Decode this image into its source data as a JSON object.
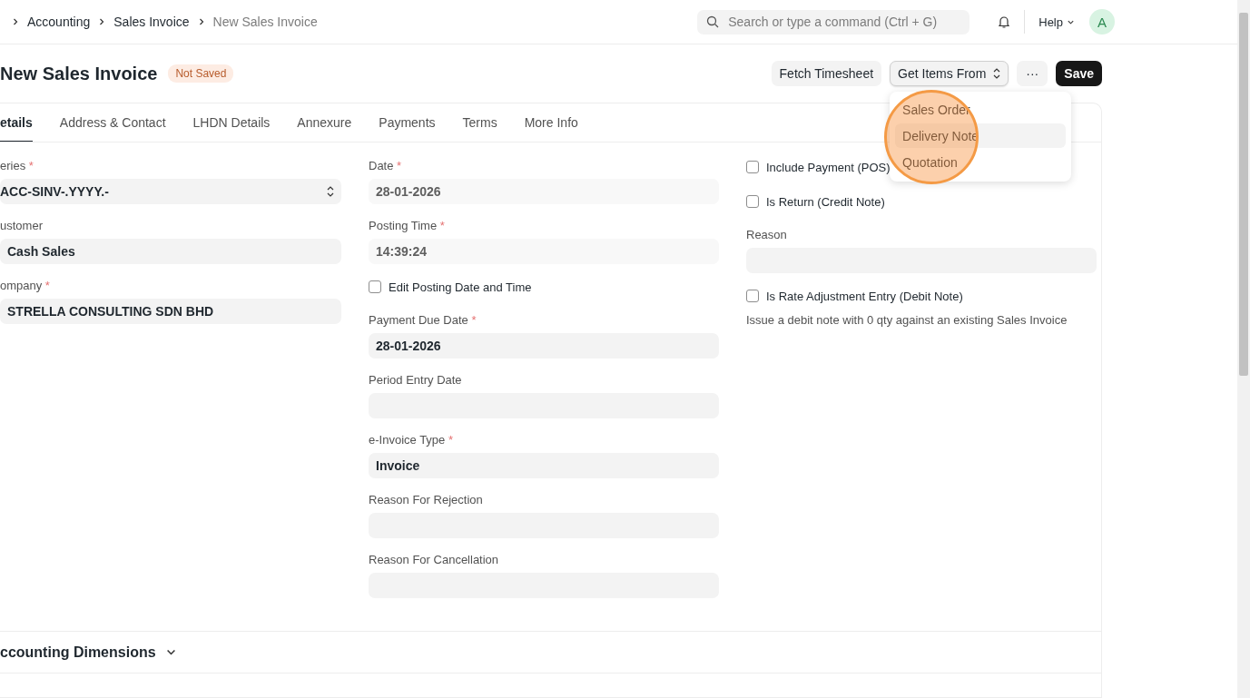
{
  "breadcrumbs": [
    {
      "label": "Accounting",
      "current": false
    },
    {
      "label": "Sales Invoice",
      "current": false
    },
    {
      "label": "New Sales Invoice",
      "current": true
    }
  ],
  "search": {
    "placeholder": "Search or type a command (Ctrl + G)"
  },
  "help": {
    "label": "Help"
  },
  "avatar": {
    "initial": "A"
  },
  "page": {
    "title": "New Sales Invoice",
    "status": "Not Saved"
  },
  "actions": [
    {
      "kind": "plain",
      "label": "Fetch Timesheet"
    },
    {
      "kind": "dropdown",
      "label": "Get Items From",
      "expanded": true
    },
    {
      "kind": "more",
      "label": "···"
    },
    {
      "kind": "primary",
      "label": "Save"
    }
  ],
  "dropdown_items": [
    {
      "label": "Sales Order",
      "selected": false
    },
    {
      "label": "Delivery Note",
      "selected": true
    },
    {
      "label": "Quotation",
      "selected": false
    }
  ],
  "click_highlight": true,
  "tabs": [
    {
      "label": "etails",
      "selected": true
    },
    {
      "label": "Address & Contact",
      "selected": false
    },
    {
      "label": "LHDN Details",
      "selected": false
    },
    {
      "label": "Annexure",
      "selected": false
    },
    {
      "label": "Payments",
      "selected": false
    },
    {
      "label": "Terms",
      "selected": false
    },
    {
      "label": "More Info",
      "selected": false
    }
  ],
  "columns": [
    [
      {
        "kind": "select",
        "label": "eries",
        "required_mark": "*",
        "value": "ACC-SINV-.YYYY.-",
        "readonly": false
      },
      {
        "kind": "field",
        "label": "ustomer",
        "value": "Cash Sales",
        "readonly": false
      },
      {
        "kind": "field",
        "label": "ompany",
        "required_mark": "*",
        "value": "STRELLA CONSULTING SDN BHD",
        "readonly": false
      }
    ],
    [
      {
        "kind": "field",
        "label": "Date",
        "required_mark": "*",
        "value": "28-01-2026",
        "readonly": true
      },
      {
        "kind": "field",
        "label": "Posting Time",
        "required_mark": "*",
        "value": "14:39:24",
        "readonly": true
      },
      {
        "kind": "checkbox",
        "label": "Edit Posting Date and Time",
        "checked": false
      },
      {
        "kind": "field",
        "label": "Payment Due Date",
        "required_mark": "*",
        "value": "28-01-2026",
        "readonly": false
      },
      {
        "kind": "field",
        "label": "Period Entry Date"
      },
      {
        "kind": "field",
        "label": "e-Invoice Type",
        "required_mark": "*",
        "value": "Invoice",
        "readonly": false
      },
      {
        "kind": "field",
        "label": "Reason For Rejection"
      },
      {
        "kind": "field",
        "label": "Reason For Cancellation"
      }
    ],
    [
      {
        "kind": "checkbox",
        "label": "Include Payment (POS)",
        "checked": false
      },
      {
        "kind": "checkbox",
        "label": "Is Return (Credit Note)",
        "checked": false
      },
      {
        "kind": "field",
        "label": "Reason"
      },
      {
        "kind": "checkbox",
        "label": "Is Rate Adjustment Entry (Debit Note)",
        "checked": false,
        "description": "Issue a debit note with 0 qty against an existing Sales Invoice"
      }
    ]
  ],
  "section": {
    "title": "ccounting Dimensions",
    "expanded": false
  }
}
